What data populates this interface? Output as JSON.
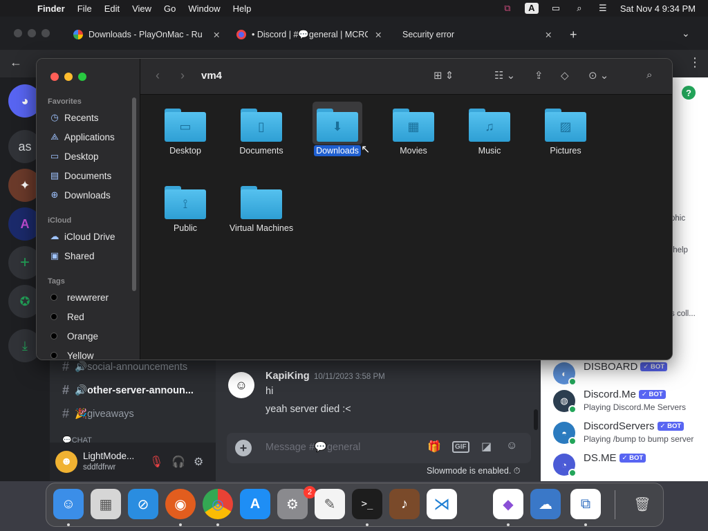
{
  "menubar": {
    "app_name": "Finder",
    "menus": [
      "File",
      "Edit",
      "View",
      "Go",
      "Window",
      "Help"
    ],
    "input_source": "A",
    "clock": "Sat Nov 4  9:34 PM"
  },
  "chrome": {
    "tabs": [
      {
        "title": "Downloads - PlayOnMac - Ru",
        "close": "✕"
      },
      {
        "title": "• Discord | #💬general | MCRC",
        "close": "✕"
      },
      {
        "title": "Security error",
        "close": "✕"
      }
    ],
    "new_tab": "+",
    "tab_menu": "⌄",
    "back": "←",
    "more": "⋮"
  },
  "discord": {
    "servers": [
      {
        "icon": "discord-logo-icon",
        "text": "◕"
      },
      {
        "icon": "server-as",
        "text": "as"
      },
      {
        "icon": "server-avatar",
        "text": "✦"
      },
      {
        "icon": "server-a-logo",
        "text": "A"
      },
      {
        "icon": "add-server-icon",
        "text": "+"
      },
      {
        "icon": "explore-icon",
        "text": "✪"
      },
      {
        "icon": "download-apps-icon",
        "text": "⤓"
      }
    ],
    "channels": [
      {
        "name": "🔊social-announcements",
        "bright": false
      },
      {
        "name": "🔊other-server-announ...",
        "bright": true
      },
      {
        "name": "🎉giveaways",
        "bright": false
      },
      {
        "name": "💬CHAT",
        "bright": false
      }
    ],
    "user": {
      "name": "LightMode...",
      "status": "sddfdfrwr",
      "avatar": "☻"
    },
    "message": {
      "author": "KapiKing",
      "timestamp": "10/11/2023 3:58 PM",
      "lines": [
        "hi",
        "yeah server died :<"
      ]
    },
    "composer_placeholder": "Message #💬general",
    "composer_gif": "GIF",
    "slowmode": "Slowmode is enabled. ⏱",
    "members_peek": [
      "phic",
      "/help",
      "s coll..."
    ],
    "members": [
      {
        "name": "DISBOARD",
        "activity": "",
        "bot": "✓ BOT",
        "color": "#5b8fd6"
      },
      {
        "name": "Discord.Me",
        "activity": "Playing Discord.Me Servers",
        "bot": "✓ BOT",
        "color": "#2c3e50"
      },
      {
        "name": "DiscordServers",
        "activity": "Playing /bump to bump server",
        "bot": "✓ BOT",
        "color": "#2b7bbf"
      },
      {
        "name": "DS.ME",
        "activity": "",
        "bot": "✓ BOT",
        "color": "#4b5bd6"
      }
    ],
    "help_icon": "?"
  },
  "finder": {
    "title": "vm4",
    "sidebar": {
      "favorites_label": "Favorites",
      "favorites": [
        {
          "label": "Recents",
          "icon": "clock-icon",
          "glyph": "◷"
        },
        {
          "label": "Applications",
          "icon": "applications-icon",
          "glyph": "⟁"
        },
        {
          "label": "Desktop",
          "icon": "desktop-icon",
          "glyph": "▭"
        },
        {
          "label": "Documents",
          "icon": "document-icon",
          "glyph": "▤"
        },
        {
          "label": "Downloads",
          "icon": "downloads-icon",
          "glyph": "⊕"
        }
      ],
      "icloud_label": "iCloud",
      "icloud": [
        {
          "label": "iCloud Drive",
          "icon": "cloud-icon",
          "glyph": "☁"
        },
        {
          "label": "Shared",
          "icon": "shared-folder-icon",
          "glyph": "▣"
        }
      ],
      "tags_label": "Tags",
      "tags": [
        {
          "label": "rewwrerer",
          "color": "#000000"
        },
        {
          "label": "Red",
          "color": "#000000"
        },
        {
          "label": "Orange",
          "color": "#000000"
        },
        {
          "label": "Yellow",
          "color": "#000000"
        }
      ]
    },
    "folders": [
      {
        "label": "Desktop",
        "glyph": "▭",
        "selected": false
      },
      {
        "label": "Documents",
        "glyph": "▯",
        "selected": false
      },
      {
        "label": "Downloads",
        "glyph": "⬇",
        "selected": true
      },
      {
        "label": "Movies",
        "glyph": "▦",
        "selected": false
      },
      {
        "label": "Music",
        "glyph": "♫",
        "selected": false
      },
      {
        "label": "Pictures",
        "glyph": "▨",
        "selected": false
      },
      {
        "label": "Public",
        "glyph": "⟟",
        "selected": false
      },
      {
        "label": "Virtual Machines",
        "glyph": "",
        "selected": false
      }
    ]
  },
  "dock": {
    "apps": [
      {
        "name": "Finder",
        "glyph": "☺",
        "color": "#3b8ee8",
        "running": true
      },
      {
        "name": "Launchpad",
        "glyph": "▦",
        "color": "#d6d6d6",
        "running": false
      },
      {
        "name": "Safari",
        "glyph": "⊘",
        "color": "#2a8de0",
        "running": false
      },
      {
        "name": "Firefox",
        "glyph": "◉",
        "color": "#e25d1e",
        "running": true
      },
      {
        "name": "Chrome",
        "glyph": "◎",
        "color": "#e8e8e8",
        "running": true
      },
      {
        "name": "App Store",
        "glyph": "A",
        "color": "#1e8ef5",
        "running": false
      },
      {
        "name": "System Settings",
        "glyph": "⚙",
        "color": "#8a8a8e",
        "running": false,
        "badge": "2"
      },
      {
        "name": "TextEdit",
        "glyph": "✎",
        "color": "#f4f4f4",
        "running": false
      },
      {
        "name": "Terminal",
        "glyph": ">_",
        "color": "#1d1d1d",
        "running": true
      },
      {
        "name": "Instruments",
        "glyph": "♪",
        "color": "#7a4a2a",
        "running": false
      },
      {
        "name": "VS Code",
        "glyph": "⋊",
        "color": "#ffffff",
        "running": false
      },
      {
        "name": "Visual Studio",
        "glyph": "◆",
        "color": "#ffffff",
        "running": true
      },
      {
        "name": "Weather",
        "glyph": "☁",
        "color": "#3a78c8",
        "running": false
      },
      {
        "name": "Parallels",
        "glyph": "⧉",
        "color": "#ffffff",
        "running": true
      },
      {
        "name": "Trash",
        "glyph": "🗑",
        "color": "transparent",
        "running": false
      }
    ]
  }
}
